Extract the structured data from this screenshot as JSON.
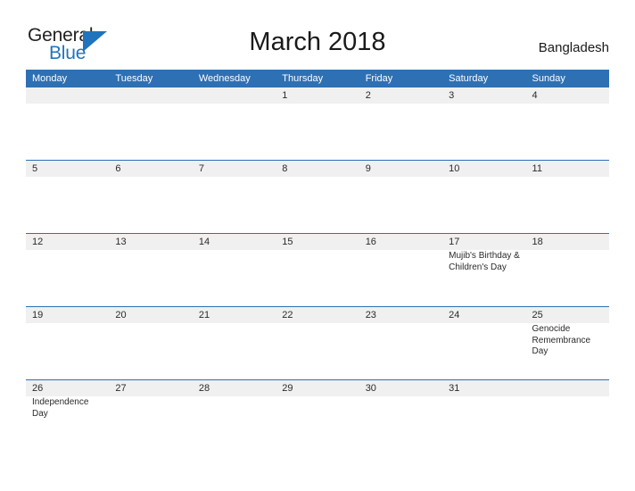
{
  "brand": {
    "name_part1": "General",
    "name_part2": "Blue",
    "flag_icon": "blue-triangle-flag-icon",
    "accent_color": "#1f74bd"
  },
  "header": {
    "title": "March 2018",
    "country": "Bangladesh"
  },
  "theme": {
    "header_blue": "#2e70b4",
    "daynum_band": "#f0f0f0",
    "body_white": "#ffffff",
    "text": "#2a2a2a"
  },
  "calendar": {
    "month": "March",
    "year": "2018",
    "weekday_headers": [
      "Monday",
      "Tuesday",
      "Wednesday",
      "Thursday",
      "Friday",
      "Saturday",
      "Sunday"
    ],
    "weeks": [
      [
        {
          "day": "",
          "events": []
        },
        {
          "day": "",
          "events": []
        },
        {
          "day": "",
          "events": []
        },
        {
          "day": "1",
          "events": []
        },
        {
          "day": "2",
          "events": []
        },
        {
          "day": "3",
          "events": []
        },
        {
          "day": "4",
          "events": []
        }
      ],
      [
        {
          "day": "5",
          "events": []
        },
        {
          "day": "6",
          "events": []
        },
        {
          "day": "7",
          "events": []
        },
        {
          "day": "8",
          "events": []
        },
        {
          "day": "9",
          "events": []
        },
        {
          "day": "10",
          "events": []
        },
        {
          "day": "11",
          "events": []
        }
      ],
      [
        {
          "day": "12",
          "events": []
        },
        {
          "day": "13",
          "events": []
        },
        {
          "day": "14",
          "events": []
        },
        {
          "day": "15",
          "events": []
        },
        {
          "day": "16",
          "events": []
        },
        {
          "day": "17",
          "events": [
            "Mujib's Birthday & Children's Day"
          ]
        },
        {
          "day": "18",
          "events": []
        }
      ],
      [
        {
          "day": "19",
          "events": []
        },
        {
          "day": "20",
          "events": []
        },
        {
          "day": "21",
          "events": []
        },
        {
          "day": "22",
          "events": []
        },
        {
          "day": "23",
          "events": []
        },
        {
          "day": "24",
          "events": []
        },
        {
          "day": "25",
          "events": [
            "Genocide Remembrance Day"
          ]
        }
      ],
      [
        {
          "day": "26",
          "events": [
            "Independence Day"
          ]
        },
        {
          "day": "27",
          "events": []
        },
        {
          "day": "28",
          "events": []
        },
        {
          "day": "29",
          "events": []
        },
        {
          "day": "30",
          "events": []
        },
        {
          "day": "31",
          "events": []
        },
        {
          "day": "",
          "events": []
        }
      ]
    ]
  }
}
